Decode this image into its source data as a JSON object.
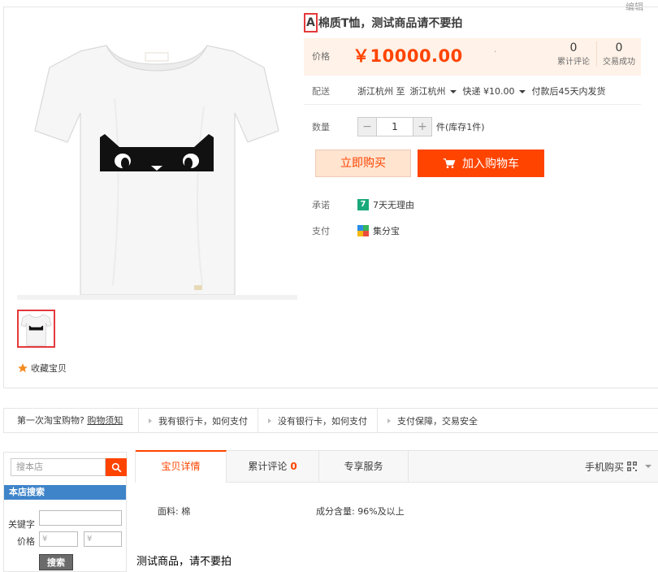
{
  "header": {
    "edit_label": "编辑"
  },
  "product": {
    "title_first_char": "A",
    "title_rest": "棉质T恤，测试商品请不要拍",
    "price_label": "价格",
    "price": "￥10000.00",
    "price_dot": "·",
    "reviews_count": "0",
    "reviews_label": "累计评论",
    "deals_count": "0",
    "deals_label": "交易成功",
    "delivery_label": "配送",
    "delivery_from": "浙江杭州 至",
    "delivery_to": "浙江杭州",
    "shipping_method": "快递",
    "shipping_fee": "¥10.00",
    "shipping_note": "付款后45天内发货",
    "quantity_label": "数量",
    "quantity_value": "1",
    "qty_minus": "−",
    "qty_plus": "+",
    "stock_text": "件(库存1件)",
    "buy_now_label": "立即购买",
    "add_cart_label": "加入购物车",
    "promise_label": "承诺",
    "promise_badge": "7",
    "promise_text": "7天无理由",
    "payment_label": "支付",
    "payment_text": "集分宝",
    "favorite_label": "收藏宝贝"
  },
  "guide_bar": {
    "first_prefix": "第一次淘宝购物?",
    "first_link": "购物须知",
    "items": [
      "我有银行卡，如何支付",
      "没有银行卡，如何支付",
      "支付保障，交易安全"
    ]
  },
  "sidebar": {
    "search_placeholder": "搜本店",
    "section_title": "本店搜索",
    "keyword_label": "关键字",
    "price_label": "价格",
    "price_min_placeholder": "¥",
    "price_max_placeholder": "¥",
    "search_button": "搜索"
  },
  "tabs": {
    "detail": "宝贝详情",
    "reviews": "累计评论",
    "reviews_count": "0",
    "service": "专享服务",
    "mobile_buy": "手机购买"
  },
  "attributes": {
    "fabric": "面料: 棉",
    "composition": "成分含量: 96%及以上"
  },
  "description": "测试商品，请不要拍",
  "colors": {
    "accent": "#ff4400",
    "price_bg": "#fff2e8",
    "store_search_blue": "#3f84c9"
  }
}
